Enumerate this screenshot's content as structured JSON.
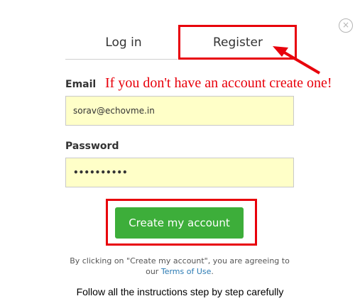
{
  "close_icon": "×",
  "tabs": {
    "login": "Log in",
    "register": "Register"
  },
  "email": {
    "label": "Email",
    "value": "sorav@echovme.in"
  },
  "annotation": "If you don't have an account create one!",
  "password": {
    "label": "Password",
    "value": "••••••••••"
  },
  "create_button": "Create my account",
  "agreement": {
    "line1": "By clicking on \"Create my account\", you are agreeing to",
    "prefix": "our ",
    "terms_link": "Terms of Use",
    "suffix": "."
  },
  "instructions": "Follow all the instructions step by step carefully",
  "colors": {
    "highlight": "#e8000b",
    "button": "#3dae3a",
    "field_bg": "#ffffc8",
    "link": "#2a7ab3"
  }
}
